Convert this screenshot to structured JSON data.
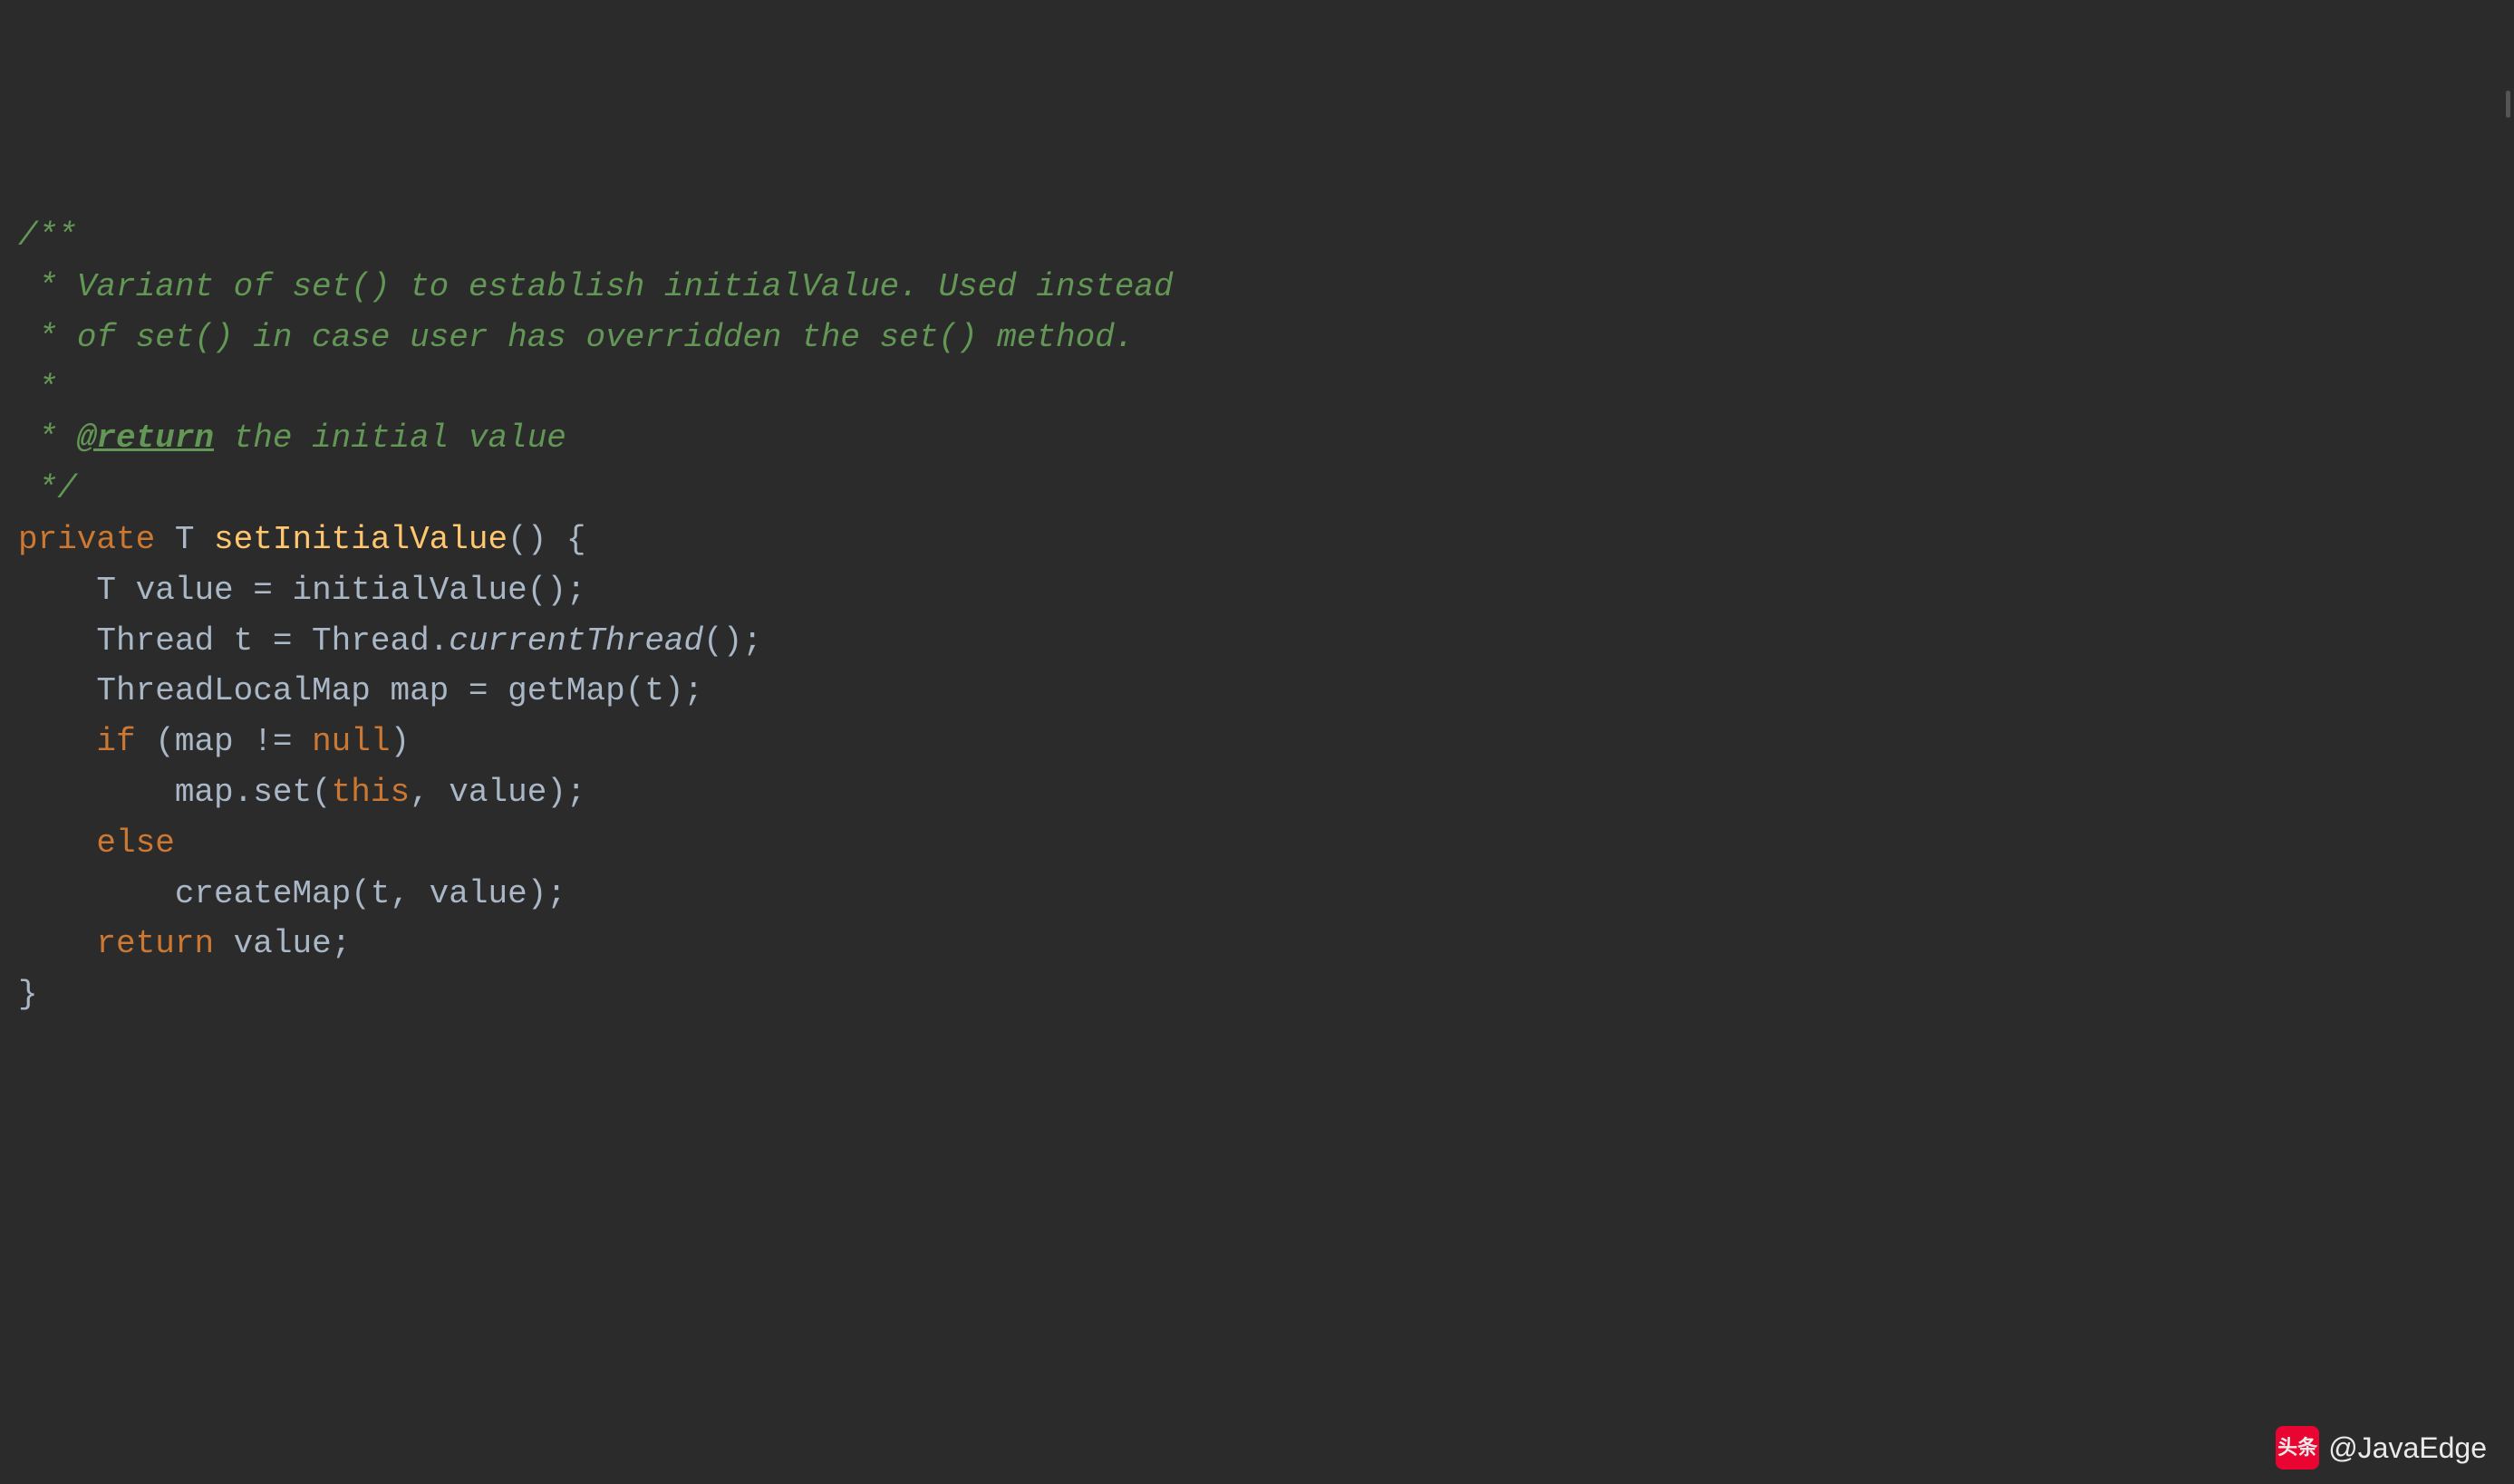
{
  "code": {
    "line1": "/**",
    "line2_prefix": " * ",
    "line2_text": "Variant of set() to establish initialValue. Used instead",
    "line3_prefix": " * ",
    "line3_text": "of set() in case user has overridden the set() method.",
    "line4": " *",
    "line5_prefix": " * ",
    "line5_tag": "@return",
    "line5_text": " the initial value",
    "line6": " */",
    "line7_private": "private",
    "line7_type": " T ",
    "line7_method": "setInitialValue",
    "line7_params": "() {",
    "line8_indent": "    ",
    "line8_type": "T ",
    "line8_var": "value = initialValue();",
    "line9_indent": "    ",
    "line9_text1": "Thread t = Thread.",
    "line9_method": "currentThread",
    "line9_text2": "();",
    "line10_indent": "    ",
    "line10_text": "ThreadLocalMap map = getMap(t);",
    "line11_indent": "    ",
    "line11_if": "if",
    "line11_cond": " (map != ",
    "line11_null": "null",
    "line11_close": ")",
    "line12_indent": "        ",
    "line12_text1": "map.set(",
    "line12_this": "this",
    "line12_text2": ", value);",
    "line13_indent": "    ",
    "line13_else": "else",
    "line14_indent": "        ",
    "line14_text": "createMap(t, value);",
    "line15_indent": "    ",
    "line15_return": "return",
    "line15_text": " value;",
    "line16": "}"
  },
  "watermark": {
    "icon_text": "头条",
    "text": "@JavaEdge"
  }
}
